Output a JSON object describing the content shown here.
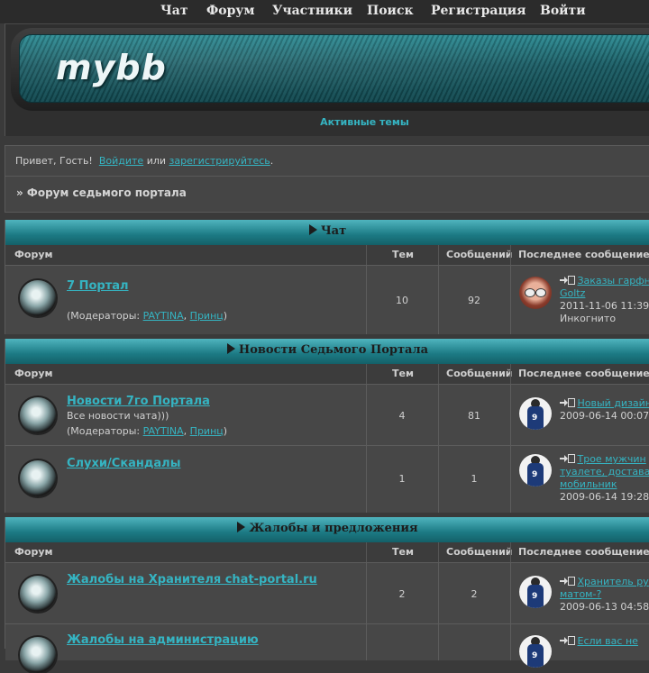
{
  "nav": {
    "items": [
      "Чат",
      "Форум",
      "Участники",
      "Поиск",
      "Регистрация",
      "Войти"
    ]
  },
  "header": {
    "logo": "mybb",
    "active_topics": "Активные темы"
  },
  "welcome": {
    "greeting": "Привет, Гость!",
    "login_link": "Войдите",
    "or_text": "или",
    "register_link": "зарегистрируйтесь",
    "period": ".",
    "breadcrumb": "» Форум седьмого портала"
  },
  "columns": {
    "forum": "Форум",
    "topics": "Тем",
    "posts": "Сообщений",
    "last_post": "Последнее сообщение"
  },
  "categories": [
    {
      "title": "Чат",
      "forums": [
        {
          "name": "7 Портал",
          "description": "",
          "moderators_prefix": "(Модераторы:",
          "moderators": [
            "PAYTINA",
            "Принц"
          ],
          "topics": "10",
          "posts": "92",
          "last_post_title_1": "Заказы гарфн",
          "last_post_title_2": "Goltz",
          "last_post_date": "2011-11-06 11:39",
          "last_post_author": "Инкогнито"
        }
      ]
    },
    {
      "title": "Новости Седьмого Портала",
      "forums": [
        {
          "name": "Новости 7го Портала",
          "description": "Все новости чата)))",
          "moderators_prefix": "(Модераторы:",
          "moderators": [
            "PAYTINA",
            "Принц"
          ],
          "topics": "4",
          "posts": "81",
          "last_post_title_1": "Новый дизайн",
          "last_post_date": "2009-06-14 00:07"
        },
        {
          "name": "Слухи/Скандалы",
          "topics": "1",
          "posts": "1",
          "last_post_title_1": "Трое мужчин",
          "last_post_title_2": "туалете, достава",
          "last_post_title_3": "мобильник",
          "last_post_date": "2009-06-14 19:28"
        }
      ]
    },
    {
      "title": "Жалобы и предложения",
      "forums": [
        {
          "name": "Жалобы на Хранителя chat-portal.ru",
          "topics": "2",
          "posts": "2",
          "last_post_title_1": "Хранитель ру",
          "last_post_title_2": "матом-?",
          "last_post_date": "2009-06-13 04:58"
        },
        {
          "name": "Жалобы на администрацию",
          "last_post_title_1": "Если вас не"
        }
      ]
    }
  ],
  "colors": {
    "accent": "#35b4c2",
    "background": "#3a3a3a",
    "category_header": "#1c7a84"
  }
}
